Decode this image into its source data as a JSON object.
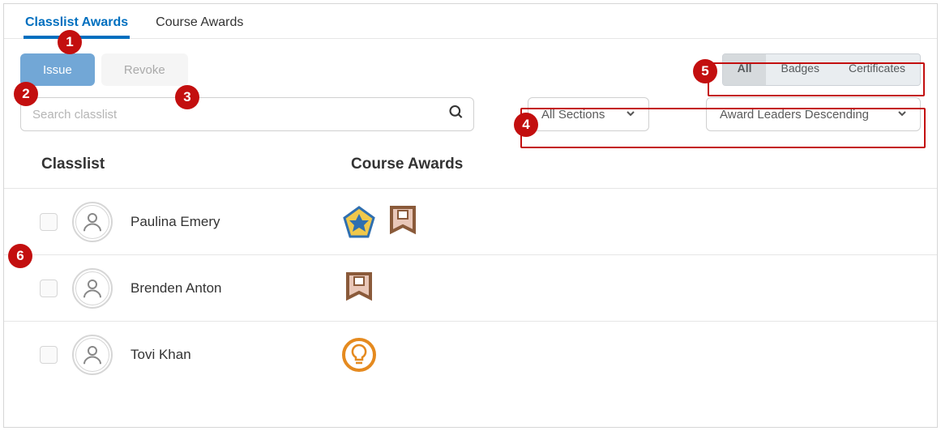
{
  "tabs": {
    "classlist_awards": "Classlist Awards",
    "course_awards": "Course Awards"
  },
  "buttons": {
    "issue": "Issue",
    "revoke": "Revoke"
  },
  "filters": {
    "all": "All",
    "badges": "Badges",
    "certificates": "Certificates"
  },
  "search": {
    "placeholder": "Search classlist"
  },
  "dropdowns": {
    "sections": "All Sections",
    "sort": "Award Leaders Descending"
  },
  "headers": {
    "classlist": "Classlist",
    "course_awards": "Course Awards"
  },
  "rows": [
    {
      "name": "Paulina Emery",
      "awards": [
        "star-pentagon",
        "book"
      ]
    },
    {
      "name": "Brenden Anton",
      "awards": [
        "book"
      ]
    },
    {
      "name": "Tovi Khan",
      "awards": [
        "bulb"
      ]
    }
  ],
  "callouts": {
    "c1": "1",
    "c2": "2",
    "c3": "3",
    "c4": "4",
    "c5": "5",
    "c6": "6"
  }
}
